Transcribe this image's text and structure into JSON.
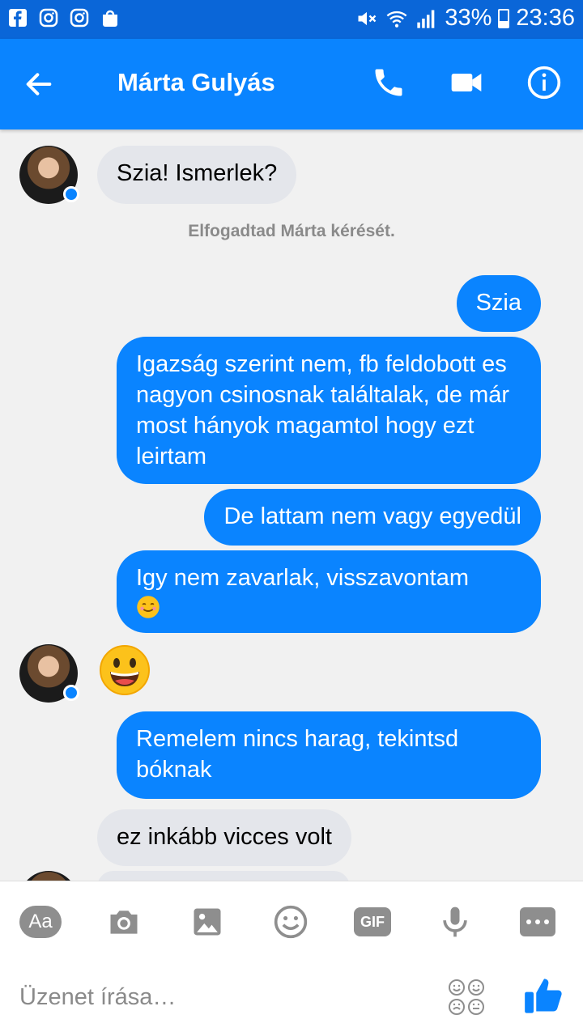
{
  "status_bar": {
    "battery": "33%",
    "time": "23:36",
    "app_icons": [
      "facebook-icon",
      "instagram-icon",
      "instagram-icon",
      "galaxy-store-icon"
    ],
    "indicators": [
      "mute-icon",
      "wifi-icon",
      "signal-icon",
      "battery-icon"
    ]
  },
  "header": {
    "contact_name": "Márta Gulyás",
    "actions": [
      "back-arrow-icon",
      "phone-icon",
      "video-camera-icon",
      "info-icon"
    ]
  },
  "conversation": {
    "msg1": "Szia!  Ismerlek?",
    "system_note": "Elfogadtad Márta kérését.",
    "msg2": "Szia",
    "msg3": "Igazság szerint nem, fb feldobott es nagyon csinosnak találtalak, de már most hányok magamtol hogy ezt leirtam",
    "msg4": "De lattam nem vagy egyedül",
    "msg5": "Igy nem zavarlak, visszavontam",
    "msg5_emoji": "☺",
    "msg6_emoji": "grinning-face",
    "msg7": "Remelem nincs harag, tekintsd bóknak",
    "msg8": "ez inkább vicces volt"
  },
  "composer": {
    "tools": [
      "Aa",
      "camera-icon",
      "image-icon",
      "emoji-icon",
      "GIF",
      "microphone-icon",
      "more-icon"
    ],
    "aa_label": "Aa",
    "gif_label": "GIF",
    "placeholder": "Üzenet írása…",
    "sticker_icon": "sticker-faces-icon",
    "like_icon": "thumbs-up-icon"
  },
  "colors": {
    "accent": "#0a84ff",
    "status_bar": "#0a66d8",
    "incoming_bubble": "#e4e6eb",
    "outgoing_bubble": "#0a84ff"
  }
}
